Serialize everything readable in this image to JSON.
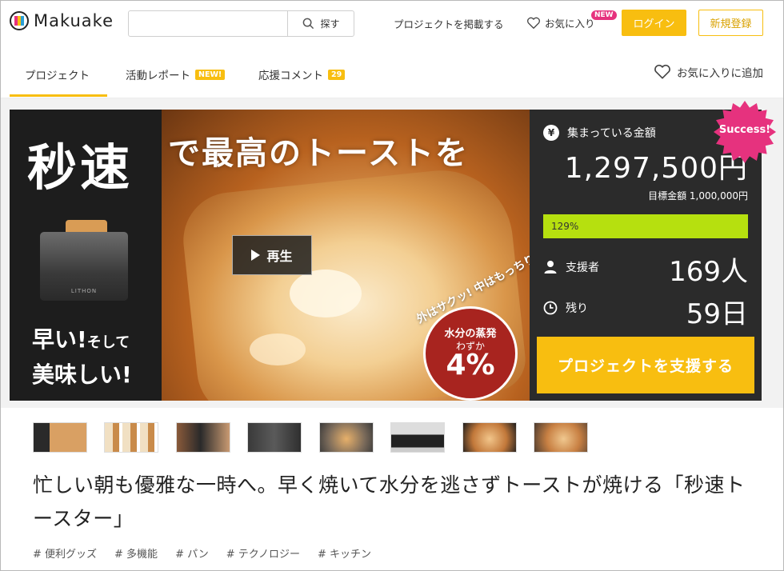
{
  "header": {
    "logo_text": "Makuake",
    "search": {
      "placeholder": "",
      "button_label": "探す"
    },
    "post_project": "プロジェクトを掲載する",
    "favorites": "お気に入り",
    "favorites_badge": "NEW",
    "login": "ログイン",
    "register": "新規登録"
  },
  "tabs": {
    "items": [
      {
        "label": "プロジェクト",
        "badge": ""
      },
      {
        "label": "活動レポート",
        "badge": "NEW!"
      },
      {
        "label": "応援コメント",
        "badge": "29"
      }
    ],
    "add_favorite": "お気に入りに追加"
  },
  "hero": {
    "title_big": "秒速",
    "title_rest": "で最高のトーストを",
    "caption_line1_big": "早い!",
    "caption_line1_small": "そして",
    "caption_line2": "美味しい!",
    "toaster_brand": "LITHON",
    "play_label": "再生",
    "arc_text": "外はサクッ! 中はもっちり",
    "badge_line1": "水分の蒸発",
    "badge_line2": "わずか",
    "badge_value": "4%"
  },
  "funding": {
    "collected_label": "集まっている金額",
    "currency_icon": "¥",
    "amount": "1,297,500円",
    "goal": "目標金額 1,000,000円",
    "progress_percent": 129,
    "progress_label": "129%",
    "supporters_label": "支援者",
    "supporters_value": "169人",
    "remaining_label": "残り",
    "remaining_value": "59日",
    "cta": "プロジェクトを支援する",
    "success_badge": "Success!"
  },
  "colors": {
    "accent": "#f8be10",
    "progress": "#b6e00f",
    "panel": "#2b2b2b",
    "new_badge": "#e6327e",
    "success": "#e6327e"
  },
  "thumbnails": [
    {
      "name": "thumb-1"
    },
    {
      "name": "thumb-2"
    },
    {
      "name": "thumb-3"
    },
    {
      "name": "thumb-4"
    },
    {
      "name": "thumb-5"
    },
    {
      "name": "thumb-6"
    },
    {
      "name": "thumb-7"
    },
    {
      "name": "thumb-8"
    }
  ],
  "project": {
    "title": "忙しい朝も優雅な一時へ。早く焼いて水分を逃さずトーストが焼ける「秒速トースター」",
    "tags": [
      "# 便利グッズ",
      "# 多機能",
      "# パン",
      "# テクノロジー",
      "# キッチン"
    ]
  }
}
